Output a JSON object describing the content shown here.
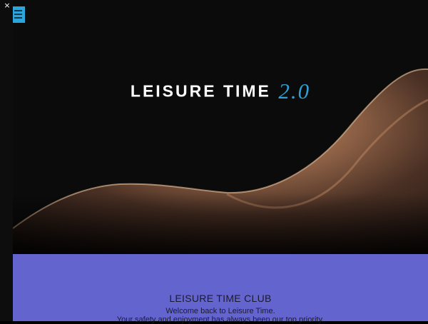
{
  "ui": {
    "close_icon_glyph": "×",
    "menu_icon": "hamburger-menu-icon"
  },
  "hero": {
    "title_main": "LEISURE TIME",
    "title_version": "2.0",
    "version_color": "#2f9fd6"
  },
  "club": {
    "heading": "LEISURE TIME CLUB",
    "line1": "Welcome back to Leisure Time.",
    "line2": "Your safety and enjoyment has always been our top priority.",
    "background_color": "#6464cf"
  }
}
